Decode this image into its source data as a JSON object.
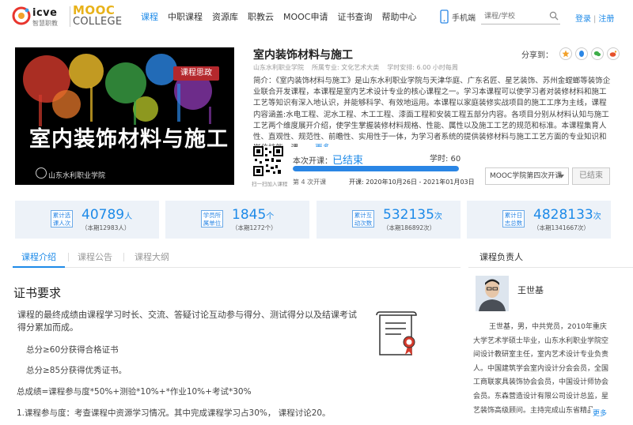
{
  "header": {
    "logo_icve": "icve",
    "logo_icve_sub": "智慧职教",
    "logo_mooc_1": "MOOC",
    "logo_mooc_2": "COLLEGE",
    "nav": [
      "课程",
      "中职课程",
      "资源库",
      "职教云",
      "MOOC申请",
      "证书查询",
      "帮助中心"
    ],
    "phone_label": "手机端",
    "search_placeholder": "课程/学校",
    "login": "登录",
    "register": "注册"
  },
  "course": {
    "badge": "课程思政",
    "cover_title": "室内装饰材料与施工",
    "cover_school": "山东水利职业学院",
    "title": "室内装饰材料与施工",
    "meta": [
      "山东水利职业学院",
      "所属专业: 文化艺术大类",
      "学时安排: 6.00 小时每周"
    ],
    "share_label": "分享到：",
    "intro": "简介：《室内装饰材料与施工》是山东水利职业学院与天津华庭、广东名匠、星艺装饰、苏州金螳螂等装饰企业联合开发课程，本课程是室内艺术设计专业的核心课程之一。学习本课程可以使学习者对装修材料和施工工艺等知识有深入地认识，并能够科学、有效地运用。本课程以家庭装修实战项目的施工工序为主线，课程内容涵盖:水电工程、泥水工程、木工工程、漆面工程和安装工程五部分内容。各项目分别从材料认知与施工工艺两个维度展开介绍，使学生掌握装修材料规格、性能、属性以及施工工艺的规范和标准。本课程集育人性、直观性、规范性、前瞻性、实用性于一体，为学习者系统的提供装修材料与施工工艺方面的专业知识和岗位技能，课......",
    "intro_more": "更多",
    "qr_label": "扫一扫加入课程",
    "session_label": "本次开课：",
    "session_status": "已结束",
    "hours_label": "学时: 60",
    "progress": 1.0,
    "term_no": "第 4 次开课",
    "dates": "开课: 2020年10月26日 - 2021年01月03日",
    "term_select": "MOOC学院第四次开课",
    "ended_button": "已结束"
  },
  "stats": [
    {
      "tag": "累计选课人次",
      "num": "40789",
      "unit": "人",
      "sub": "（本期12983人）"
    },
    {
      "tag": "学员所属单位",
      "num": "1845",
      "unit": "个",
      "sub": "（本期1272个）"
    },
    {
      "tag": "累计互动次数",
      "num": "532135",
      "unit": "次",
      "sub": "（本期186892次）"
    },
    {
      "tag": "累计日志总数",
      "num": "4828133",
      "unit": "次",
      "sub": "（本期1341667次）"
    }
  ],
  "tabs": [
    "课程介绍",
    "课程公告",
    "课程大纲"
  ],
  "right_head": "课程负责人",
  "cert": {
    "title": "证书要求",
    "desc": "课程的最终成绩由课程学习时长、交流、答疑讨论互动参与得分、测试得分以及结课考试得分累加而成。",
    "line1": "总分≥60分获得合格证书",
    "line2": "总分≥85分获得优秀证书。",
    "line3": "总成绩=课程参与度*50%+测验*10%+*作业10%+考试*30%",
    "line4": "1.课程参与度：考查课程中资源学习情况。其中完成课程学习占30%， 课程讨论20。"
  },
  "teacher": {
    "name": "王世基",
    "bio": "王世基，男，中共党员，2010年重庆大学艺术学硕士毕业，山东水利职业学院空间设计教研室主任，室内艺术设计专业负责人。中国建筑学会室内设计分会会员，全国工商联家具装饰协会会员，中国设计师协会会员。东森营造设计有限公司设计总监，星艺装饰高级顾问。主持完成山东省精品",
    "more": "更多"
  }
}
